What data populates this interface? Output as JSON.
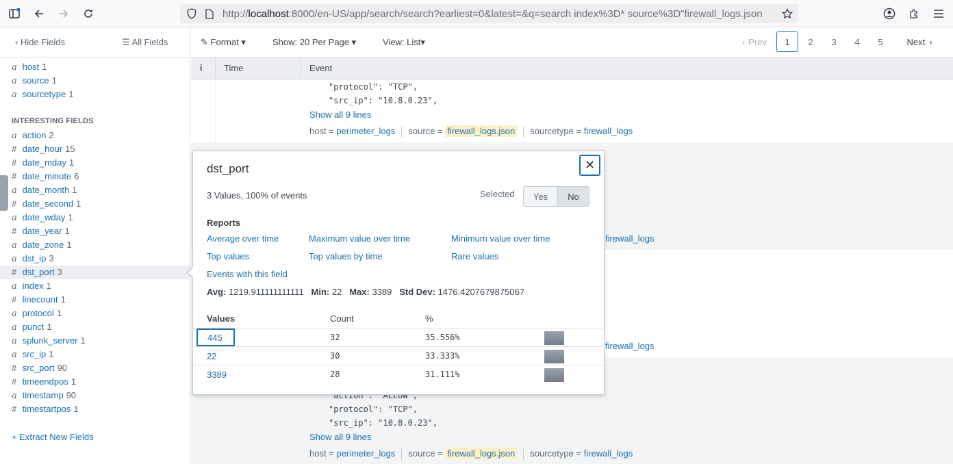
{
  "browser": {
    "url_prefix": "http://",
    "url_host": "localhost",
    "url_rest": ":8000/en-US/app/search/search?earliest=0&latest=&q=search index%3D* source%3D\"firewall_logs.json"
  },
  "sidebar": {
    "hide_fields": "Hide Fields",
    "all_fields": "All Fields",
    "selected_fields": [
      {
        "type": "a",
        "name": "host",
        "count": "1"
      },
      {
        "type": "a",
        "name": "source",
        "count": "1"
      },
      {
        "type": "a",
        "name": "sourcetype",
        "count": "1"
      }
    ],
    "interesting_heading": "INTERESTING FIELDS",
    "interesting_fields": [
      {
        "type": "a",
        "name": "action",
        "count": "2"
      },
      {
        "type": "#",
        "name": "date_hour",
        "count": "15"
      },
      {
        "type": "#",
        "name": "date_mday",
        "count": "1"
      },
      {
        "type": "#",
        "name": "date_minute",
        "count": "6"
      },
      {
        "type": "a",
        "name": "date_month",
        "count": "1"
      },
      {
        "type": "#",
        "name": "date_second",
        "count": "1"
      },
      {
        "type": "a",
        "name": "date_wday",
        "count": "1"
      },
      {
        "type": "#",
        "name": "date_year",
        "count": "1"
      },
      {
        "type": "a",
        "name": "date_zone",
        "count": "1"
      },
      {
        "type": "a",
        "name": "dst_ip",
        "count": "3"
      },
      {
        "type": "#",
        "name": "dst_port",
        "count": "3"
      },
      {
        "type": "a",
        "name": "index",
        "count": "1"
      },
      {
        "type": "#",
        "name": "linecount",
        "count": "1"
      },
      {
        "type": "a",
        "name": "protocol",
        "count": "1"
      },
      {
        "type": "a",
        "name": "punct",
        "count": "1"
      },
      {
        "type": "a",
        "name": "splunk_server",
        "count": "1"
      },
      {
        "type": "a",
        "name": "src_ip",
        "count": "1"
      },
      {
        "type": "#",
        "name": "src_port",
        "count": "90"
      },
      {
        "type": "#",
        "name": "timeendpos",
        "count": "1"
      },
      {
        "type": "a",
        "name": "timestamp",
        "count": "90"
      },
      {
        "type": "#",
        "name": "timestartpos",
        "count": "1"
      }
    ],
    "extract": "+ Extract New Fields"
  },
  "toolbar": {
    "format": "Format",
    "show": "Show: 20 Per Page",
    "view": "View: List",
    "prev": "Prev",
    "pages": [
      "1",
      "2",
      "3",
      "4",
      "5"
    ],
    "next": "Next"
  },
  "table": {
    "info": "i",
    "time": "Time",
    "event": "Event"
  },
  "events": {
    "line_protocol": "\"protocol\": \"TCP\",",
    "line_src_ip": "\"src_ip\": \"10.8.0.23\",",
    "line_action": "\"action\": \"ALLOW\",",
    "show_all": "Show all 9 lines",
    "host_key": "host =",
    "host_val": "perimeter_logs",
    "source_key": "source =",
    "source_val": "firewall_logs.json",
    "sourcetype_key": "sourcetype =",
    "sourcetype_val": "firewall_logs"
  },
  "popup": {
    "title": "dst_port",
    "subtitle": "3 Values, 100% of events",
    "selected_label": "Selected",
    "yes": "Yes",
    "no": "No",
    "reports_heading": "Reports",
    "reports": {
      "avg": "Average over time",
      "max": "Maximum value over time",
      "min": "Minimum value over time",
      "top": "Top values",
      "top_time": "Top values by time",
      "rare": "Rare values",
      "events": "Events with this field"
    },
    "stats": {
      "avg_label": "Avg:",
      "avg": "1219.911111111111",
      "min_label": "Min:",
      "min": "22",
      "max_label": "Max:",
      "max": "3389",
      "std_label": "Std Dev:",
      "std": "1476.4207679875067"
    },
    "headers": {
      "values": "Values",
      "count": "Count",
      "pct": "%"
    },
    "rows": [
      {
        "value": "445",
        "count": "32",
        "pct": "35.556%",
        "fraction": 0.35556
      },
      {
        "value": "22",
        "count": "30",
        "pct": "33.333%",
        "fraction": 0.33333
      },
      {
        "value": "3389",
        "count": "28",
        "pct": "31.111%",
        "fraction": 0.31111
      }
    ]
  }
}
